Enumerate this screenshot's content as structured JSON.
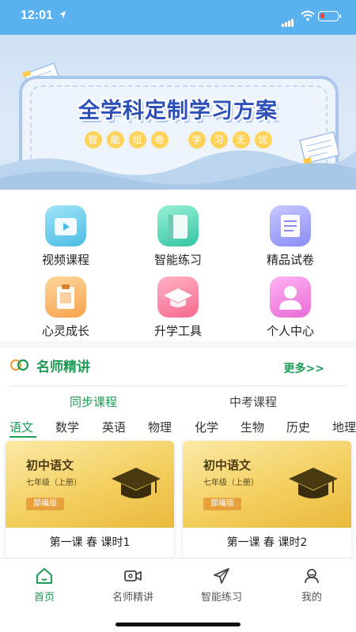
{
  "status_bar": {
    "time": "12:01"
  },
  "banner": {
    "title": "全学科定制学习方案",
    "chips": [
      "智",
      "能",
      "组",
      "卷",
      "学",
      "习",
      "无",
      "忧"
    ]
  },
  "grid": {
    "items": [
      {
        "label": "视频课程",
        "icon": "video-course-icon"
      },
      {
        "label": "智能练习",
        "icon": "smart-practice-icon"
      },
      {
        "label": "精品试卷",
        "icon": "exam-paper-icon"
      },
      {
        "label": "心灵成长",
        "icon": "mind-growth-icon"
      },
      {
        "label": "升学工具",
        "icon": "graduation-tool-icon"
      },
      {
        "label": "个人中心",
        "icon": "user-center-icon"
      }
    ]
  },
  "teachers": {
    "title": "名师精讲",
    "more": "更多>>",
    "tabs": [
      "同步课程",
      "中考课程"
    ],
    "subjects": [
      "语文",
      "数学",
      "英语",
      "物理",
      "化学",
      "生物",
      "历史",
      "地理"
    ],
    "cards": [
      {
        "cover_title": "初中语文",
        "grade": "七年级（上册）",
        "badge": "部编版",
        "label": "第一课 春 课时1"
      },
      {
        "cover_title": "初中语文",
        "grade": "七年级（上册）",
        "badge": "部编版",
        "label": "第一课 春 课时2"
      }
    ]
  },
  "nav": {
    "items": [
      {
        "label": "首页",
        "icon": "home-icon"
      },
      {
        "label": "名师精讲",
        "icon": "camera-icon"
      },
      {
        "label": "智能练习",
        "icon": "paper-plane-icon"
      },
      {
        "label": "我的",
        "icon": "profile-icon"
      }
    ]
  },
  "colors": {
    "accent": "#1d9c55",
    "status_bar": "#5ab1ef",
    "card_gold": "#f3cf5f"
  }
}
